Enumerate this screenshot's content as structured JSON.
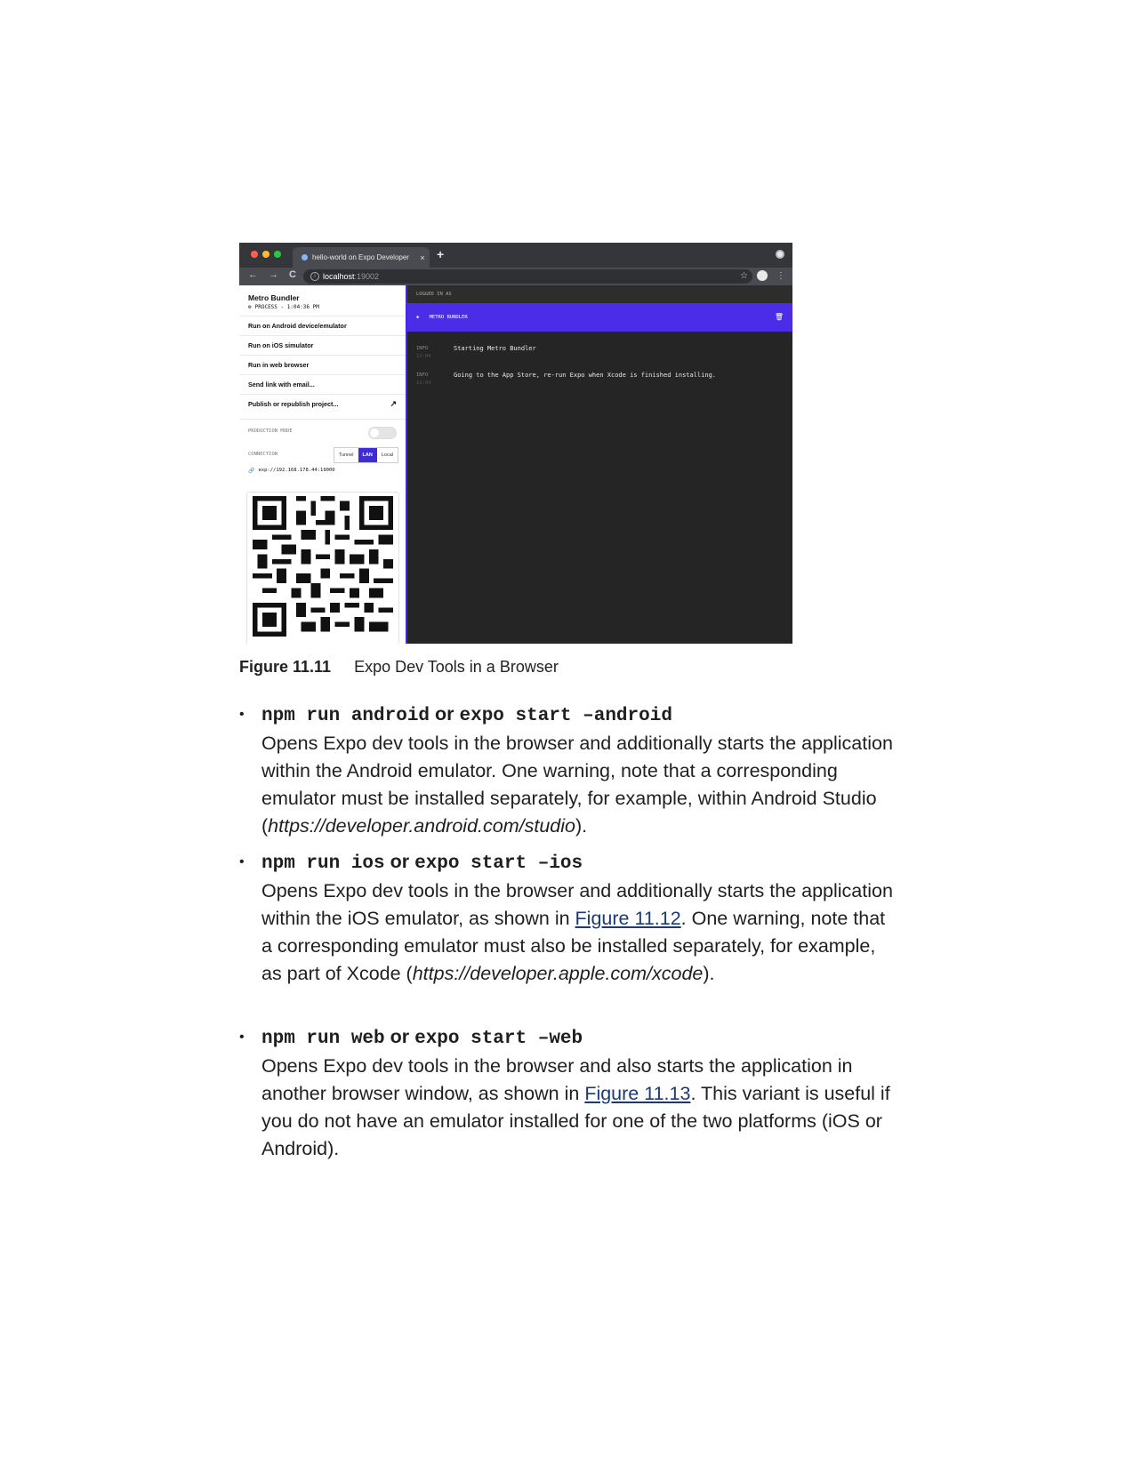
{
  "browser": {
    "colors": {
      "dot_red": "#ff5f57",
      "dot_yellow": "#febc2e",
      "dot_green": "#28c840",
      "accent": "#4b2de8"
    },
    "tab_title": "hello-world on Expo Developer",
    "tab_close": "×",
    "new_tab": "+",
    "nav_back": "←",
    "nav_forward": "→",
    "nav_reload": "C",
    "omnibox_info": "i",
    "url_host": "localhost",
    "url_port": ":19002",
    "bookmark": "☆",
    "menu": "⋮"
  },
  "sidebar": {
    "title": "Metro Bundler",
    "process_icon": "⚙",
    "process": "PROCESS - 1:04:36 PM",
    "items": [
      {
        "label": "Run on Android device/emulator"
      },
      {
        "label": "Run on iOS simulator"
      },
      {
        "label": "Run in web browser"
      },
      {
        "label": "Send link with email..."
      },
      {
        "label": "Publish or republish project..."
      }
    ],
    "external_icon": "↗",
    "production_mode_label": "PRODUCTION MODE",
    "connection_label": "CONNECTION",
    "connection_options": [
      "Tunnel",
      "LAN",
      "Local"
    ],
    "connection_selected": "LAN",
    "link_icon": "🔗",
    "exp_url": "exp://192.168.178.44:19000"
  },
  "console": {
    "logged_in": "LOGGED IN AS",
    "bundler_icon": "◈",
    "bundler_title": "METRO BUNDLER",
    "trash_icon": "🗑",
    "logs": [
      {
        "level": "INFO",
        "time": "13:04",
        "message": "Starting Metro Bundler"
      },
      {
        "level": "INFO",
        "time": "13:04",
        "message": "Going to the App Store, re-run Expo when Xcode is finished installing."
      }
    ]
  },
  "caption": {
    "number": "Figure 11.11",
    "text": "Expo Dev Tools in a Browser"
  },
  "bullets": [
    {
      "cmd1": "npm run android",
      "or": "or",
      "cmd2": "expo start –android",
      "text1": "Opens Expo dev tools in the browser and additionally starts the application within the Android emulator. One warning, note that a corresponding emulator must be installed separately, for example, within Android Studio (",
      "url": "https://developer.android.com/studio",
      "text2": ")."
    },
    {
      "cmd1": "npm run ios",
      "or": "or",
      "cmd2": "expo start –ios",
      "text1": "Opens Expo dev tools in the browser and additionally starts the application within the iOS emulator, as shown in ",
      "link": "Figure 11.12",
      "text2": ". One warning, note that a corresponding emulator must also be installed separately, for example, as part of Xcode (",
      "url": "https://developer.apple.com/xcode",
      "text3": ")."
    },
    {
      "cmd1": "npm run web",
      "or": "or",
      "cmd2": "expo start –web",
      "text1": "Opens Expo dev tools in the browser and also starts the application in another browser window, as shown in ",
      "link": "Figure 11.13",
      "text2": ". This variant is useful if you do not have an emulator installed for one of the two platforms (iOS or Android)."
    }
  ]
}
